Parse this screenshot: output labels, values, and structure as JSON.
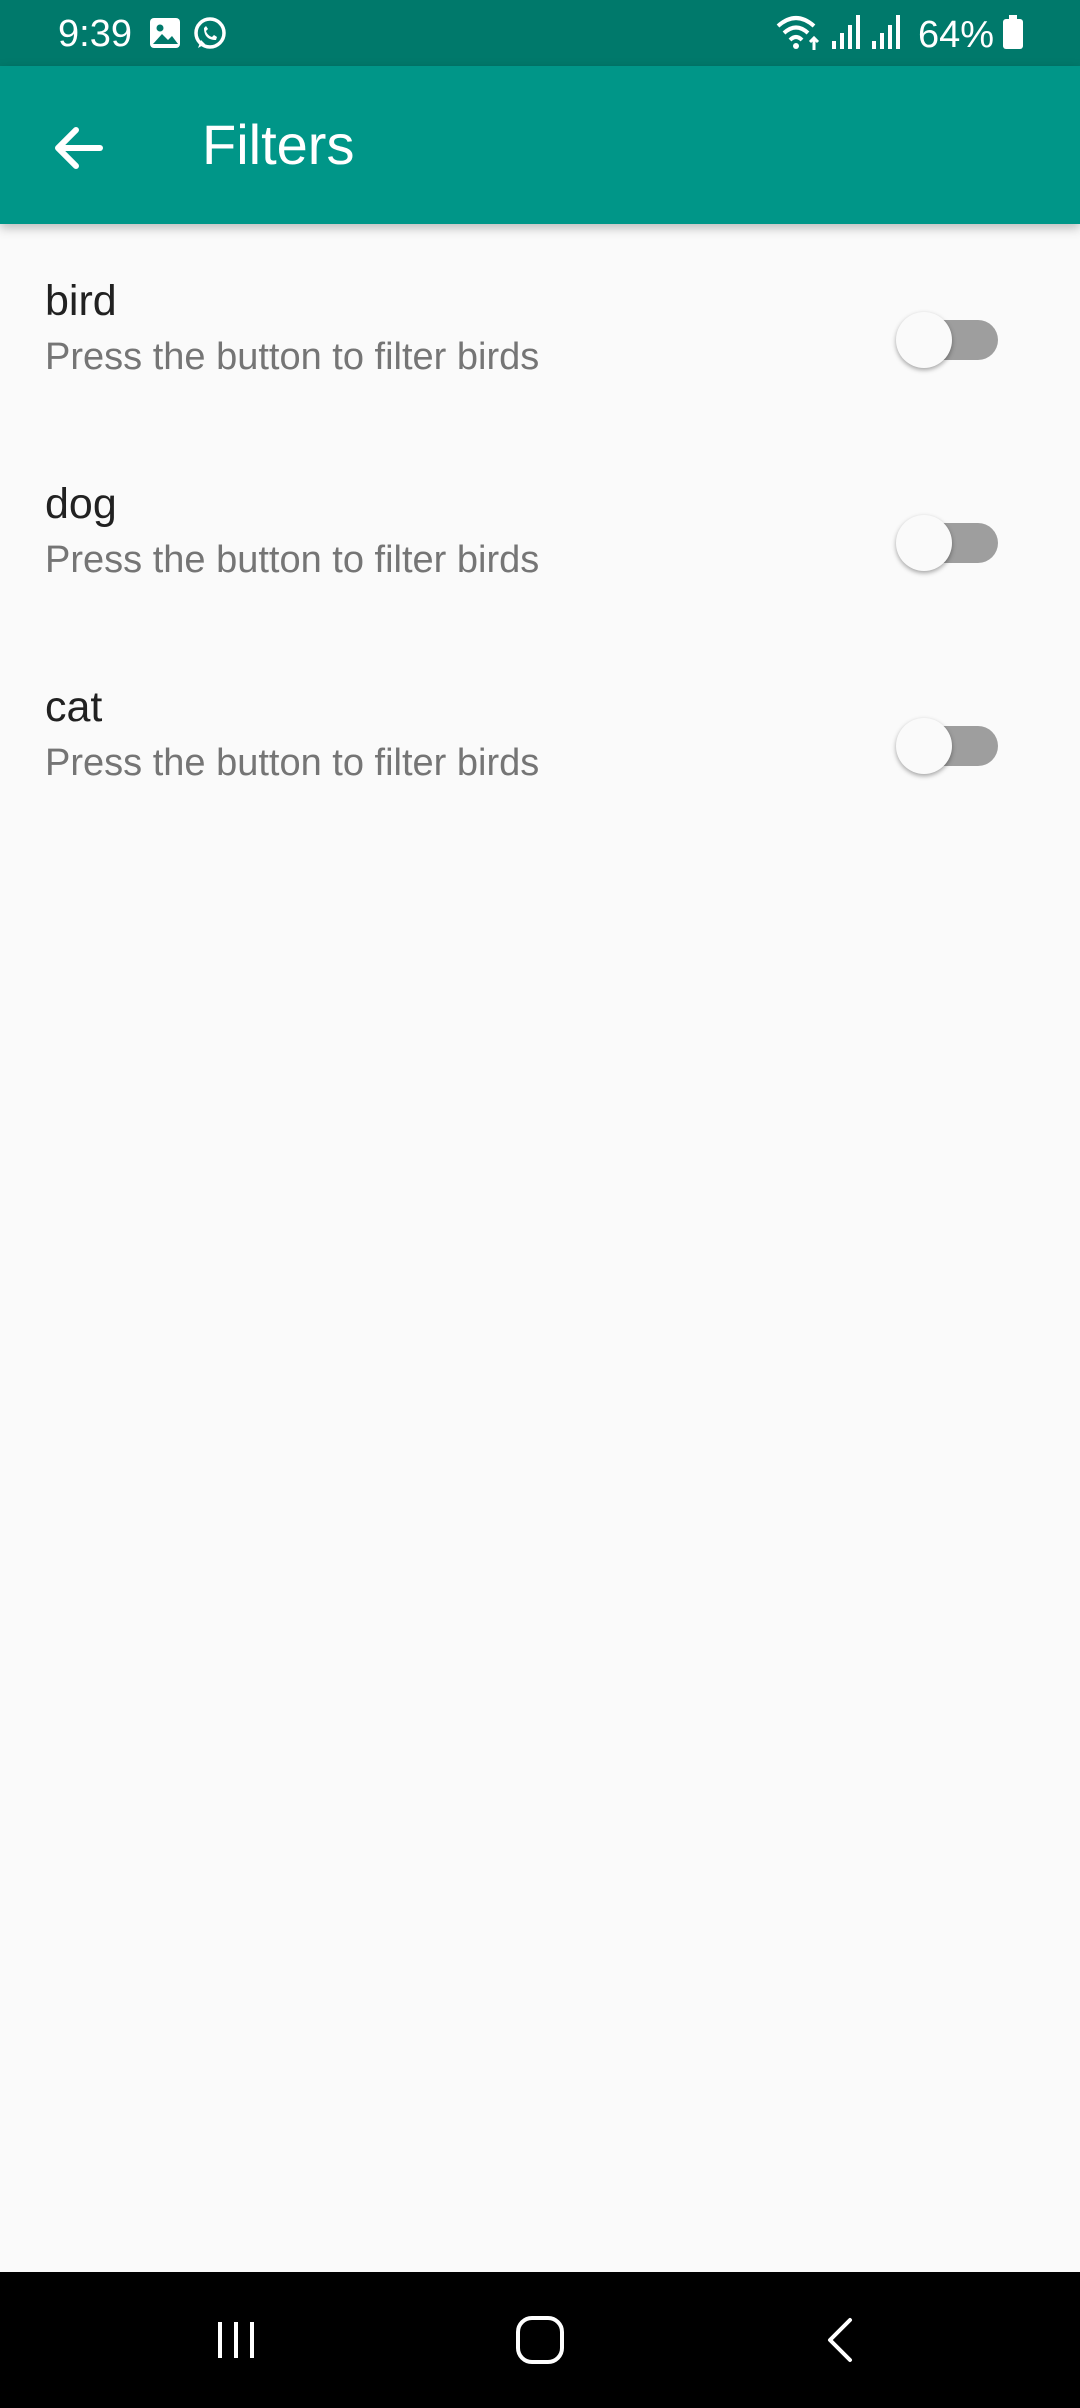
{
  "status_bar": {
    "time": "9:39",
    "battery": "64%",
    "left_icons": [
      "gallery-icon",
      "whatsapp-icon"
    ],
    "right_icons": [
      "wifi-icon",
      "signal-icon",
      "signal-icon",
      "battery-icon"
    ]
  },
  "app_bar": {
    "title": "Filters",
    "back_icon": "arrow-back-icon",
    "color": "#009688",
    "status_color": "#00796b"
  },
  "filters": [
    {
      "title": "bird",
      "subtitle": "Press the button to filter birds",
      "enabled": false
    },
    {
      "title": "dog",
      "subtitle": "Press the button to filter birds",
      "enabled": false
    },
    {
      "title": "cat",
      "subtitle": "Press the button to filter birds",
      "enabled": false
    }
  ],
  "nav_bar": {
    "buttons": [
      "recents-icon",
      "home-icon",
      "back-icon"
    ]
  }
}
